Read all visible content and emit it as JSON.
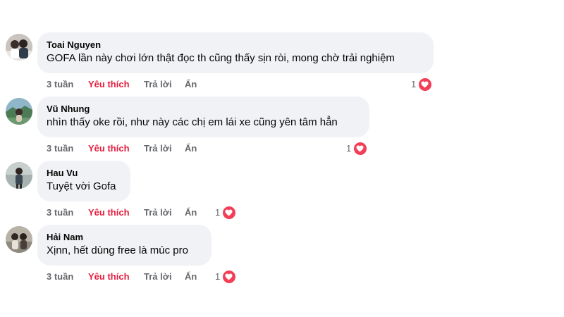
{
  "comments": [
    {
      "author": "Toai Nguyen",
      "text": "GOFA lần này chơi lớn thật đọc th cũng thấy sịn ròi, mong chờ trải nghiệm",
      "time": "3 tuần",
      "like_label": "Yêu thích",
      "reply_label": "Trả lời",
      "hide_label": "Ẩn",
      "reaction_count": "1",
      "reaction_icon": "heart-icon"
    },
    {
      "author": "Vũ Nhung",
      "text": "nhìn thấy oke rồi, như này các chị em lái xe cũng yên tâm hẳn",
      "time": "3 tuần",
      "like_label": "Yêu thích",
      "reply_label": "Trả lời",
      "hide_label": "Ẩn",
      "reaction_count": "1",
      "reaction_icon": "heart-icon"
    },
    {
      "author": "Hau Vu",
      "text": "Tuyệt vời Gofa",
      "time": "3 tuần",
      "like_label": "Yêu thích",
      "reply_label": "Trả lời",
      "hide_label": "Ẩn",
      "reaction_count": "1",
      "reaction_icon": "heart-icon"
    },
    {
      "author": "Hải Nam",
      "text": "Xịnn, hết dùng free là múc pro",
      "time": "3 tuần",
      "like_label": "Yêu thích",
      "reply_label": "Trả lời",
      "hide_label": "Ẩn",
      "reaction_count": "1",
      "reaction_icon": "heart-icon"
    }
  ],
  "colors": {
    "bubble_bg": "#f0f2f5",
    "like_active": "#e41e3f",
    "meta_text": "#65676b",
    "heart": "#f33e58"
  }
}
